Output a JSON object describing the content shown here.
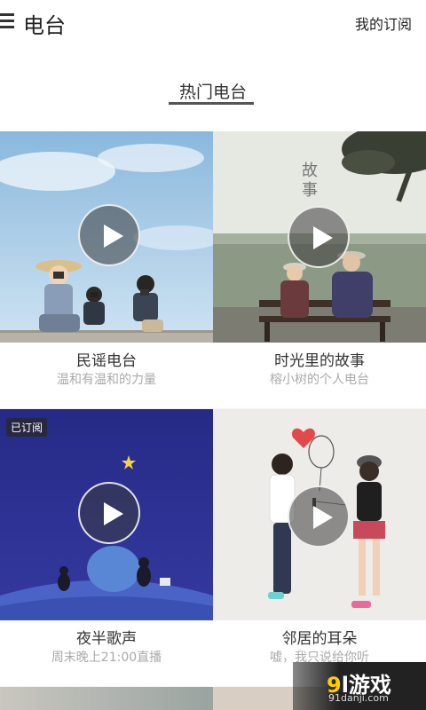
{
  "header": {
    "title": "电台",
    "subscribe_label": "我的订阅"
  },
  "section": {
    "title": "热门电台"
  },
  "stations": [
    {
      "name": "民谣电台",
      "desc": "温和有温和的力量"
    },
    {
      "name": "时光里的故事",
      "desc": "榕小树的个人电台",
      "art_text": "故事"
    },
    {
      "name": "夜半歌声",
      "desc": "周末晚上21:00直播",
      "badge": "已订阅"
    },
    {
      "name": "邻居的耳朵",
      "desc": "嘘，我只说给你听"
    }
  ],
  "watermark": {
    "logo_prefix": "9",
    "logo_rest": "l游戏",
    "url": "91danji.com"
  },
  "icons": {
    "menu": "menu-icon",
    "play": "play-icon"
  },
  "colors": {
    "accent_yellow": "#ffcc00",
    "night_blue": "#2a2f8a"
  }
}
